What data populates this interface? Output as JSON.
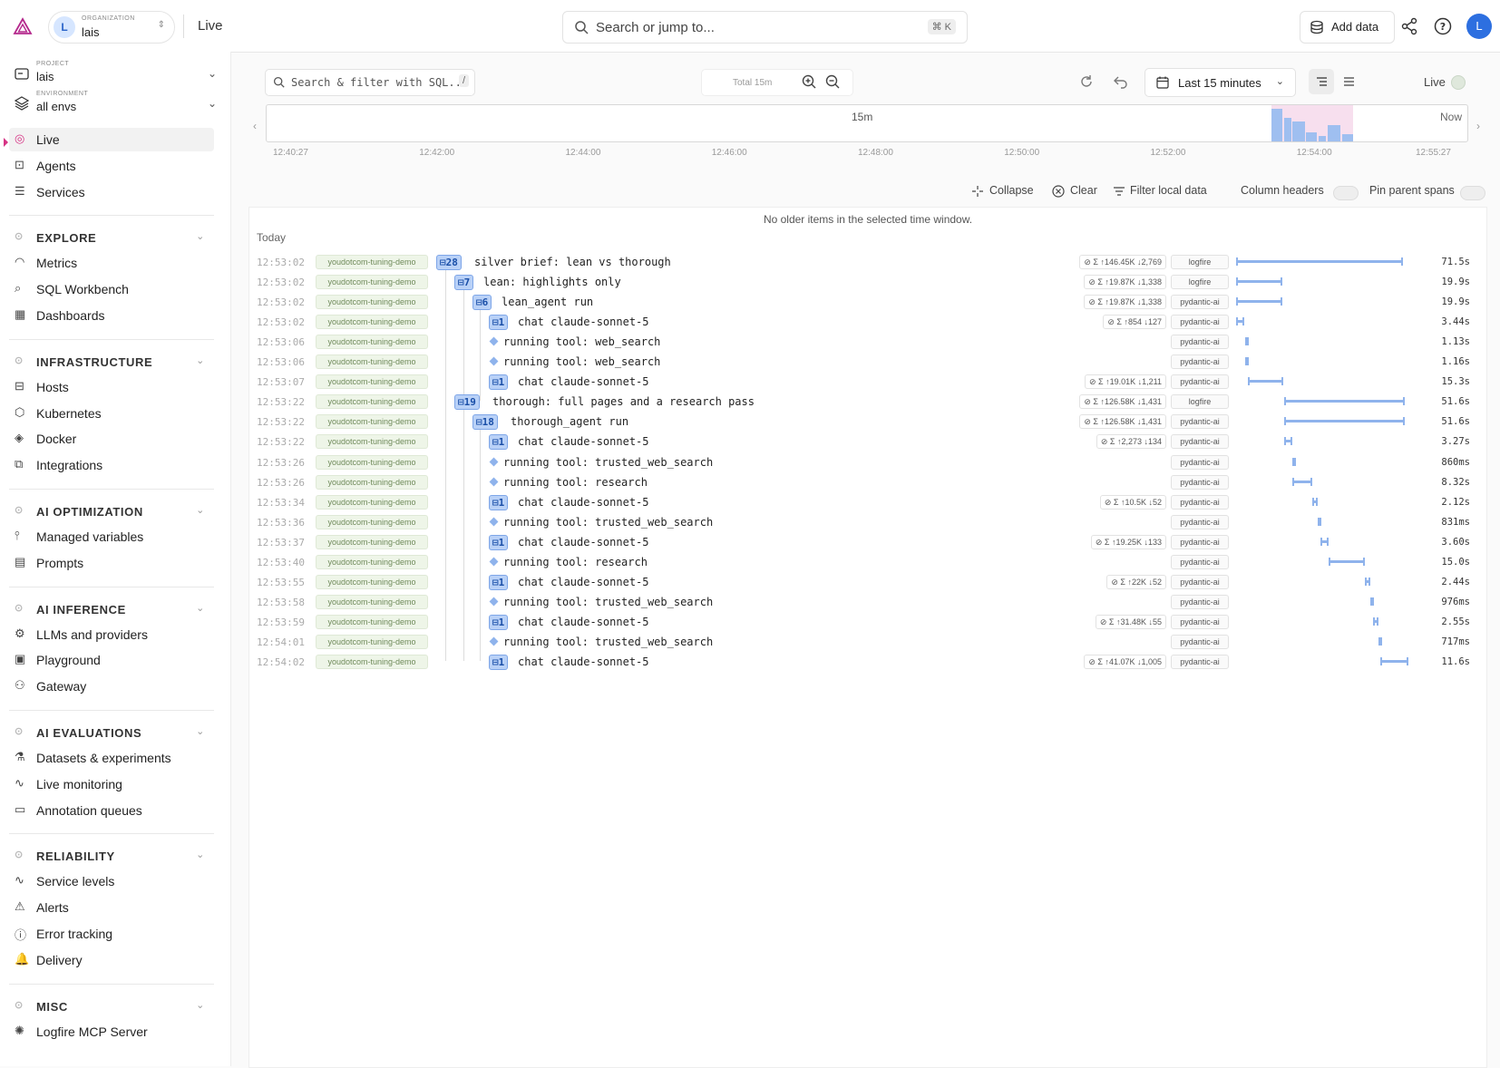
{
  "topbar": {
    "org_label": "ORGANIZATION",
    "org_initial": "L",
    "org_name": "lais",
    "page": "Live",
    "search_placeholder": "Search or jump to...",
    "search_shortcut": "⌘ K",
    "add_data": "Add data",
    "user_initial": "L"
  },
  "sidebar": {
    "project_label": "PROJECT",
    "project": "lais",
    "env_label": "ENVIRONMENT",
    "env": "all envs",
    "top_items": [
      {
        "label": "Live",
        "icon": "live-icon"
      },
      {
        "label": "Agents",
        "icon": "robot-icon"
      },
      {
        "label": "Services",
        "icon": "server-icon"
      }
    ],
    "sections": [
      {
        "title": "EXPLORE",
        "items": [
          "Metrics",
          "SQL Workbench",
          "Dashboards"
        ]
      },
      {
        "title": "INFRASTRUCTURE",
        "items": [
          "Hosts",
          "Kubernetes",
          "Docker",
          "Integrations"
        ]
      },
      {
        "title": "AI OPTIMIZATION",
        "items": [
          "Managed variables",
          "Prompts"
        ]
      },
      {
        "title": "AI INFERENCE",
        "items": [
          "LLMs and providers",
          "Playground",
          "Gateway"
        ]
      },
      {
        "title": "AI EVALUATIONS",
        "items": [
          "Datasets & experiments",
          "Live monitoring",
          "Annotation queues"
        ]
      },
      {
        "title": "RELIABILITY",
        "items": [
          "Service levels",
          "Alerts",
          "Error tracking",
          "Delivery"
        ]
      },
      {
        "title": "MISC",
        "items": [
          "Logfire MCP Server"
        ]
      }
    ]
  },
  "toolbar": {
    "sql_placeholder": "Search & filter with SQL...",
    "slash": "/",
    "total": "Total 15m",
    "time_range": "Last 15 minutes",
    "live": "Live"
  },
  "timeline": {
    "span_label": "15m",
    "now": "Now",
    "ticks": [
      "12:40:27",
      "12:42:00",
      "12:44:00",
      "12:46:00",
      "12:48:00",
      "12:50:00",
      "12:52:00",
      "12:54:00",
      "12:55:27"
    ]
  },
  "controls": {
    "collapse": "Collapse",
    "clear": "Clear",
    "filter": "Filter local data",
    "column_headers": "Column headers",
    "pin_parent": "Pin parent spans"
  },
  "table": {
    "no_older": "No older items in the selected time window.",
    "today": "Today",
    "service": "youdotcom-tuning-demo",
    "rows": [
      {
        "time": "12:53:02",
        "depth": 0,
        "count": "28",
        "name": "silver brief: lean vs thorough",
        "tokens": "Σ ↑146.45K ↓2,769",
        "tag": "logfire",
        "bar_start": 0.0,
        "bar_len": 0.93,
        "dur": "71.5s"
      },
      {
        "time": "12:53:02",
        "depth": 1,
        "count": "7",
        "name": "lean: highlights only",
        "tokens": "Σ ↑19.87K ↓1,338",
        "tag": "logfire",
        "bar_start": 0.0,
        "bar_len": 0.26,
        "dur": "19.9s"
      },
      {
        "time": "12:53:02",
        "depth": 2,
        "count": "6",
        "name": "lean_agent run",
        "tokens": "Σ ↑19.87K ↓1,338",
        "tag": "pydantic-ai",
        "bar_start": 0.0,
        "bar_len": 0.26,
        "dur": "19.9s"
      },
      {
        "time": "12:53:02",
        "depth": 3,
        "count": "1",
        "name": "chat claude-sonnet-5",
        "tokens": "Σ ↑854 ↓127",
        "tag": "pydantic-ai",
        "bar_start": 0.0,
        "bar_len": 0.045,
        "dur": "3.44s"
      },
      {
        "time": "12:53:06",
        "depth": 3,
        "count": "",
        "name": "running tool: web_search",
        "tokens": "",
        "tag": "pydantic-ai",
        "bar_start": 0.05,
        "bar_len": 0.015,
        "dur": "1.13s"
      },
      {
        "time": "12:53:06",
        "depth": 3,
        "count": "",
        "name": "running tool: web_search",
        "tokens": "",
        "tag": "pydantic-ai",
        "bar_start": 0.05,
        "bar_len": 0.015,
        "dur": "1.16s"
      },
      {
        "time": "12:53:07",
        "depth": 3,
        "count": "1",
        "name": "chat claude-sonnet-5",
        "tokens": "Σ ↑19.01K ↓1,211",
        "tag": "pydantic-ai",
        "bar_start": 0.065,
        "bar_len": 0.2,
        "dur": "15.3s"
      },
      {
        "time": "12:53:22",
        "depth": 1,
        "count": "19",
        "name": "thorough: full pages and a research pass",
        "tokens": "Σ ↑126.58K ↓1,431",
        "tag": "logfire",
        "bar_start": 0.27,
        "bar_len": 0.67,
        "dur": "51.6s"
      },
      {
        "time": "12:53:22",
        "depth": 2,
        "count": "18",
        "name": "thorough_agent run",
        "tokens": "Σ ↑126.58K ↓1,431",
        "tag": "pydantic-ai",
        "bar_start": 0.27,
        "bar_len": 0.67,
        "dur": "51.6s"
      },
      {
        "time": "12:53:22",
        "depth": 3,
        "count": "1",
        "name": "chat claude-sonnet-5",
        "tokens": "Σ ↑2,273 ↓134",
        "tag": "pydantic-ai",
        "bar_start": 0.27,
        "bar_len": 0.045,
        "dur": "3.27s"
      },
      {
        "time": "12:53:26",
        "depth": 3,
        "count": "",
        "name": "running tool: trusted_web_search",
        "tokens": "",
        "tag": "pydantic-ai",
        "bar_start": 0.315,
        "bar_len": 0.012,
        "dur": "860ms"
      },
      {
        "time": "12:53:26",
        "depth": 3,
        "count": "",
        "name": "running tool: research",
        "tokens": "",
        "tag": "pydantic-ai",
        "bar_start": 0.315,
        "bar_len": 0.11,
        "dur": "8.32s"
      },
      {
        "time": "12:53:34",
        "depth": 3,
        "count": "1",
        "name": "chat claude-sonnet-5",
        "tokens": "Σ ↑10.5K ↓52",
        "tag": "pydantic-ai",
        "bar_start": 0.425,
        "bar_len": 0.03,
        "dur": "2.12s"
      },
      {
        "time": "12:53:36",
        "depth": 3,
        "count": "",
        "name": "running tool: trusted_web_search",
        "tokens": "",
        "tag": "pydantic-ai",
        "bar_start": 0.455,
        "bar_len": 0.012,
        "dur": "831ms"
      },
      {
        "time": "12:53:37",
        "depth": 3,
        "count": "1",
        "name": "chat claude-sonnet-5",
        "tokens": "Σ ↑19.25K ↓133",
        "tag": "pydantic-ai",
        "bar_start": 0.468,
        "bar_len": 0.048,
        "dur": "3.60s"
      },
      {
        "time": "12:53:40",
        "depth": 3,
        "count": "",
        "name": "running tool: research",
        "tokens": "",
        "tag": "pydantic-ai",
        "bar_start": 0.516,
        "bar_len": 0.2,
        "dur": "15.0s"
      },
      {
        "time": "12:53:55",
        "depth": 3,
        "count": "1",
        "name": "chat claude-sonnet-5",
        "tokens": "Σ ↑22K ↓52",
        "tag": "pydantic-ai",
        "bar_start": 0.716,
        "bar_len": 0.032,
        "dur": "2.44s"
      },
      {
        "time": "12:53:58",
        "depth": 3,
        "count": "",
        "name": "running tool: trusted_web_search",
        "tokens": "",
        "tag": "pydantic-ai",
        "bar_start": 0.748,
        "bar_len": 0.013,
        "dur": "976ms"
      },
      {
        "time": "12:53:59",
        "depth": 3,
        "count": "1",
        "name": "chat claude-sonnet-5",
        "tokens": "Σ ↑31.48K ↓55",
        "tag": "pydantic-ai",
        "bar_start": 0.761,
        "bar_len": 0.034,
        "dur": "2.55s"
      },
      {
        "time": "12:54:01",
        "depth": 3,
        "count": "",
        "name": "running tool: trusted_web_search",
        "tokens": "",
        "tag": "pydantic-ai",
        "bar_start": 0.795,
        "bar_len": 0.01,
        "dur": "717ms"
      },
      {
        "time": "12:54:02",
        "depth": 3,
        "count": "1",
        "name": "chat claude-sonnet-5",
        "tokens": "Σ ↑41.07K ↓1,005",
        "tag": "pydantic-ai",
        "bar_start": 0.805,
        "bar_len": 0.155,
        "dur": "11.6s"
      }
    ]
  },
  "colors": {
    "accent": "#2d6fe0",
    "live_marker": "#d63384",
    "span_bar": "#8fb3ec"
  }
}
